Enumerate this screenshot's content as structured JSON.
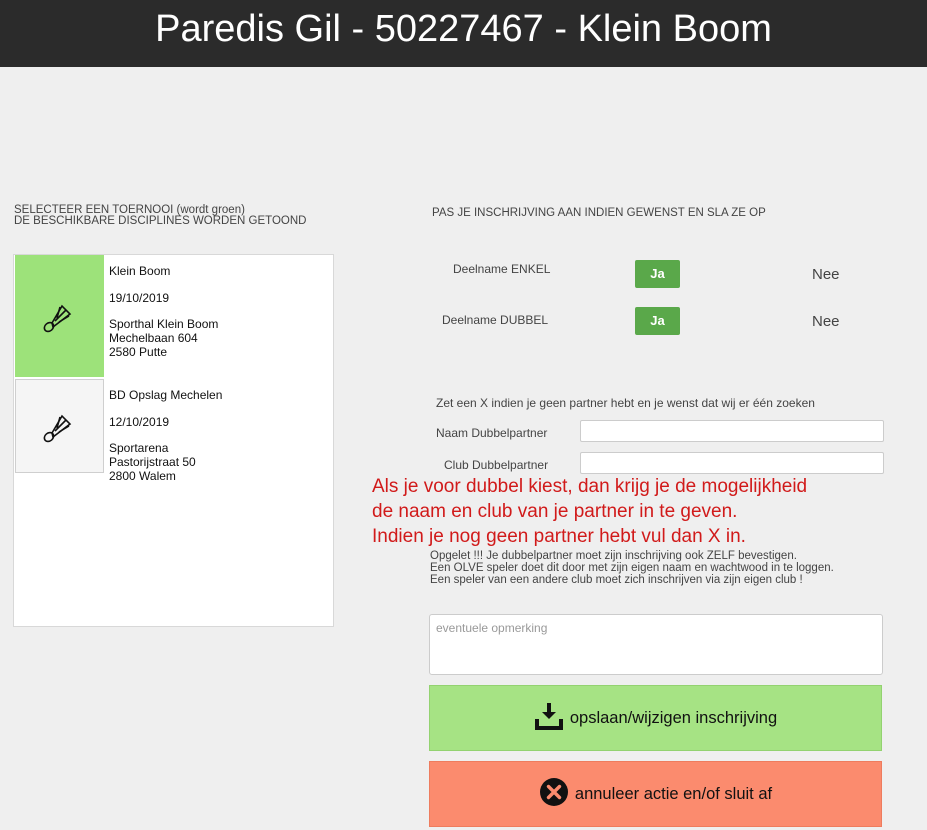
{
  "header": {
    "title": "Paredis Gil - 50227467 - Klein Boom"
  },
  "left": {
    "heading_line1": "SELECTEER EEN TOERNOOI (wordt groen)",
    "heading_line2": "DE BESCHIKBARE DISCIPLINES WORDEN GETOOND",
    "tournaments": [
      {
        "name": "Klein Boom",
        "date": "19/10/2019",
        "venue": "Sporthal Klein Boom",
        "street": "Mechelbaan 604",
        "city": "2580 Putte",
        "selected": true,
        "icon": "shuttlecock-icon"
      },
      {
        "name": "BD Opslag Mechelen",
        "date": "12/10/2019",
        "venue": "Sportarena",
        "street": "Pastorijstraat 50",
        "city": "2800 Walem",
        "selected": false,
        "icon": "shuttlecock-icon"
      }
    ]
  },
  "right": {
    "heading": "PAS JE INSCHRIJVING AAN INDIEN GEWENST EN SLA ZE OP",
    "disciplines": [
      {
        "label": "Deelname ENKEL",
        "yes": "Ja",
        "no": "Nee",
        "selected": "yes"
      },
      {
        "label": "Deelname DUBBEL",
        "yes": "Ja",
        "no": "Nee",
        "selected": "yes"
      }
    ],
    "partner_hint": "Zet een X indien je geen partner hebt en je wenst dat wij er één zoeken",
    "partner_name_label": "Naam Dubbelpartner",
    "partner_name_value": "",
    "partner_club_label": "Club Dubbelpartner",
    "partner_club_value": "",
    "red_note": [
      "Als je voor dubbel kiest, dan krijg je de mogelijkheid",
      "de naam en club van je partner in te geven.",
      "Indien je nog geen partner hebt vul dan X in."
    ],
    "warning": [
      "Opgelet !!! Je dubbelpartner moet zijn inschrijving ook ZELF bevestigen.",
      "Een OLVE speler doet dit door met zijn eigen naam en wachtwood in te loggen.",
      "Een speler van een andere club moet zich inschrijven via zijn eigen club !"
    ],
    "remark_placeholder": "eventuele opmerking",
    "save_label": "opslaan/wijzigen inschrijving",
    "cancel_label": "annuleer actie en/of sluit af"
  },
  "colors": {
    "selected_green": "#9de27a",
    "ja_green": "#5aa84a",
    "save_green": "#a6e384",
    "cancel_orange": "#fb8b6e",
    "note_red": "#d11a1a",
    "header_bg": "#2b2b2b"
  }
}
